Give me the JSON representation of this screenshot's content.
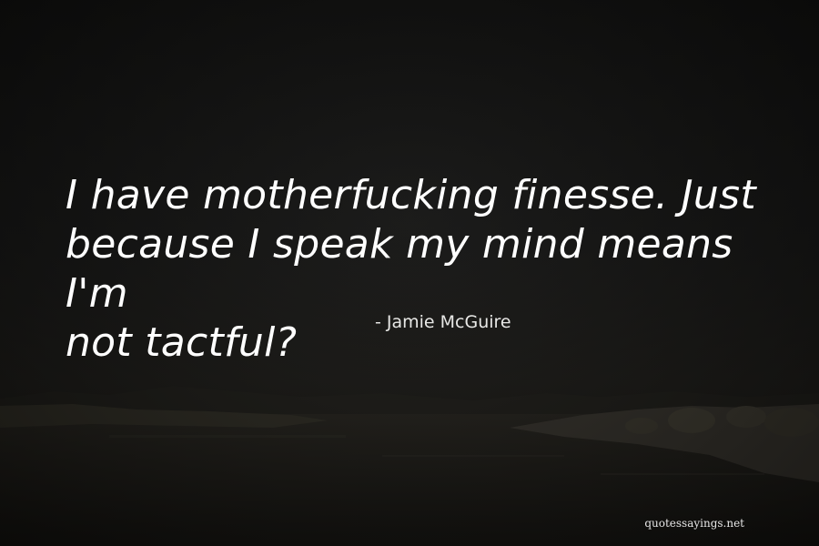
{
  "quote": {
    "line1": "I have motherfucking finesse. Just",
    "line2": "because I speak my mind means I'm",
    "line3": "not tactful?"
  },
  "author": "- Jamie McGuire",
  "watermark": "quotessayings.net",
  "colors": {
    "sky": "#121211",
    "water": "#1e1c18",
    "land": "#2a2820",
    "text": "#ffffff"
  }
}
